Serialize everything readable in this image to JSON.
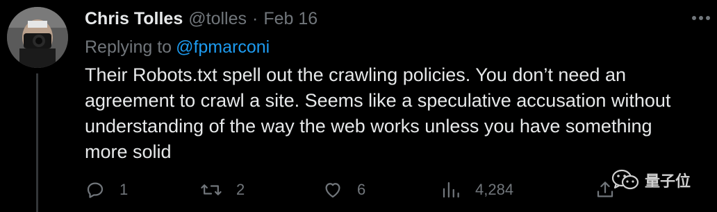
{
  "tweet": {
    "author_name": "Chris Tolles",
    "author_handle": "@tolles",
    "separator": "·",
    "date": "Feb 16",
    "replying_to_label": "Replying to",
    "replying_to_handle": "@fpmarconi",
    "body_lines": [
      "Their Robots.txt spell out the crawling policies. You don’t need an",
      "agreement to crawl a site. Seems like a speculative accusation without",
      "understanding of the way the web works unless you have something",
      "more solid"
    ],
    "actions": {
      "reply_count": "1",
      "retweet_count": "2",
      "like_count": "6",
      "views_count": "4,284"
    },
    "icons": {
      "reply": "reply-icon",
      "retweet": "retweet-icon",
      "like": "heart-icon",
      "views": "views-icon",
      "share": "share-icon",
      "more": "more-icon"
    }
  },
  "watermark": {
    "text": "量子位",
    "icon": "wechat-icon"
  },
  "colors": {
    "background": "#000000",
    "primary_text": "#e7e9ea",
    "secondary_text": "#71767b",
    "link": "#1d9bf0"
  }
}
